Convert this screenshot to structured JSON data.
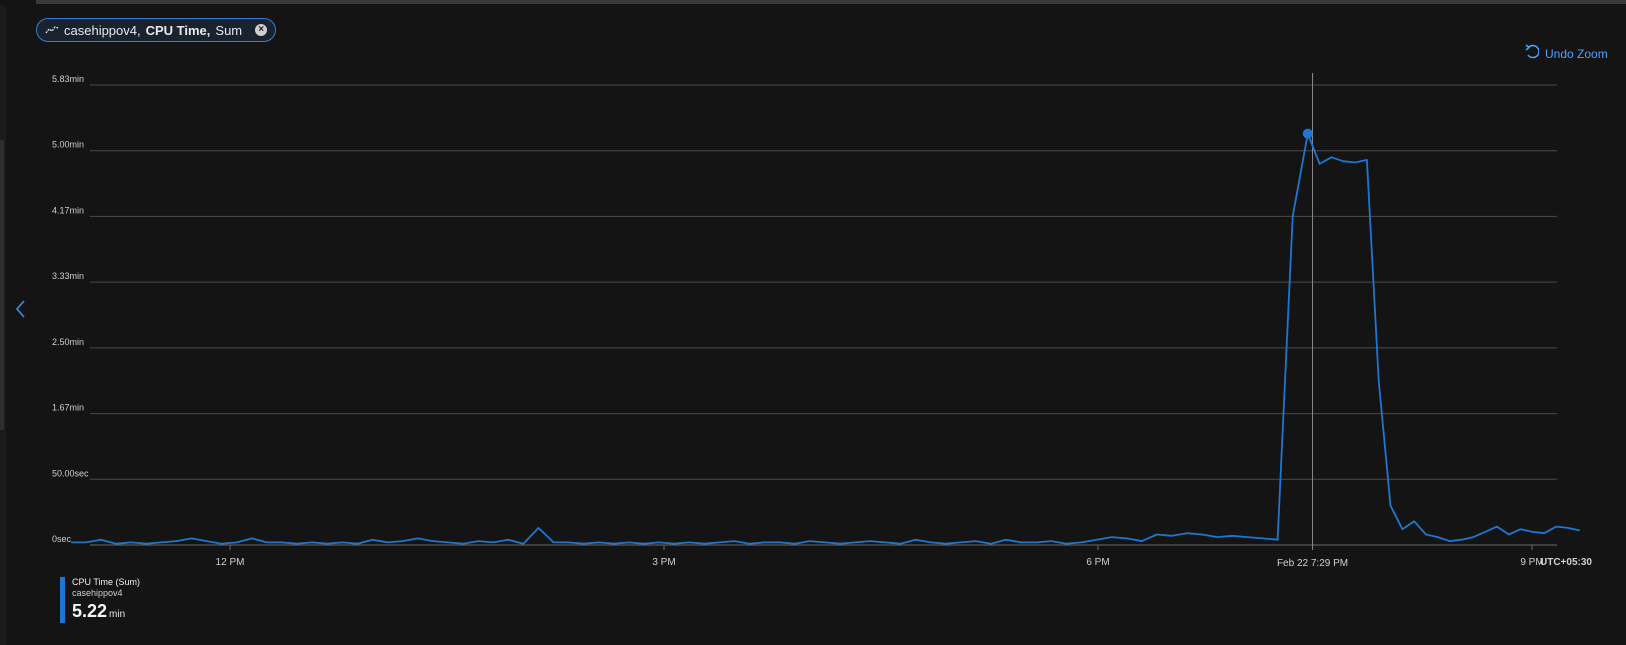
{
  "pill": {
    "resource": "casehippov4,",
    "metric": "CPU Time,",
    "aggregation": "Sum",
    "icon": "line-chart-icon"
  },
  "undo_zoom": {
    "label": "Undo Zoom",
    "icon": "undo-icon"
  },
  "timezone": "UTC+05:30",
  "crosshair_label": "Feb 22 7:29 PM",
  "legend": {
    "title": "CPU Time (Sum)",
    "resource": "casehippov4",
    "value": "5.22",
    "unit": "min",
    "color": "#1f76d2"
  },
  "chart_data": {
    "type": "line",
    "ylabel_ticks": [
      "0sec",
      "50.00sec",
      "1.67min",
      "2.50min",
      "3.33min",
      "4.17min",
      "5.00min",
      "5.83min"
    ],
    "ylim_seconds": [
      0,
      350
    ],
    "ytick_values_seconds": [
      0,
      50,
      100,
      150,
      200,
      250,
      300,
      350
    ],
    "xticks": [
      {
        "label": "12 PM",
        "hour": 12.0
      },
      {
        "label": "3 PM",
        "hour": 15.0
      },
      {
        "label": "6 PM",
        "hour": 18.0
      },
      {
        "label": "9 PM",
        "hour": 21.0
      }
    ],
    "xlim_hours": [
      10.9,
      21.35
    ],
    "crosshair_hour": 19.483,
    "highlight_point": {
      "hour": 19.45,
      "value_seconds": 313
    },
    "series": [
      {
        "color": "#1f76d2",
        "x_hours": [
          10.9,
          11.02,
          11.15,
          11.27,
          11.4,
          11.52,
          11.65,
          11.77,
          11.9,
          12.02,
          12.15,
          12.27,
          12.4,
          12.52,
          12.65,
          12.77,
          12.9,
          13.02,
          13.15,
          13.27,
          13.4,
          13.52,
          13.65,
          13.77,
          13.9,
          14.02,
          14.15,
          14.27,
          14.4,
          14.52,
          14.65,
          14.77,
          14.9,
          15.02,
          15.15,
          15.27,
          15.4,
          15.52,
          15.65,
          15.77,
          15.9,
          16.02,
          16.15,
          16.27,
          16.4,
          16.52,
          16.65,
          16.77,
          16.9,
          17.02,
          17.15,
          17.27,
          17.4,
          17.52,
          17.65,
          17.77,
          17.9,
          18.02,
          18.15,
          18.27,
          18.4,
          18.52,
          18.65,
          18.77,
          18.9,
          19.02,
          19.15,
          19.22,
          19.3,
          19.38,
          19.45,
          19.53,
          19.6,
          19.68,
          19.75,
          19.83,
          19.92,
          20.02,
          20.1,
          20.18,
          20.27,
          20.35,
          20.45,
          20.55,
          20.65,
          20.75,
          20.85,
          20.95,
          21.05,
          21.15,
          21.25,
          21.33
        ],
        "values_seconds": [
          2,
          2,
          4,
          1,
          2,
          1,
          2,
          3,
          5,
          3,
          1,
          2,
          5,
          2,
          2,
          1,
          2,
          1,
          2,
          1,
          4,
          2,
          3,
          5,
          3,
          2,
          1,
          3,
          2,
          4,
          1,
          13,
          2,
          2,
          1,
          2,
          1,
          2,
          1,
          2,
          1,
          2,
          1,
          2,
          3,
          1,
          2,
          2,
          1,
          3,
          2,
          1,
          2,
          3,
          2,
          1,
          4,
          2,
          1,
          2,
          3,
          1,
          4,
          2,
          2,
          3,
          1,
          2,
          4,
          6,
          5,
          3,
          8,
          7,
          9,
          8,
          6,
          7,
          6,
          5,
          4,
          250,
          313,
          290,
          295,
          292,
          291,
          293,
          125,
          30,
          12,
          18,
          8,
          6,
          3,
          4,
          6,
          10,
          14,
          8,
          12,
          10,
          9,
          14,
          13,
          11
        ],
        "path_hours_override": null
      }
    ]
  }
}
